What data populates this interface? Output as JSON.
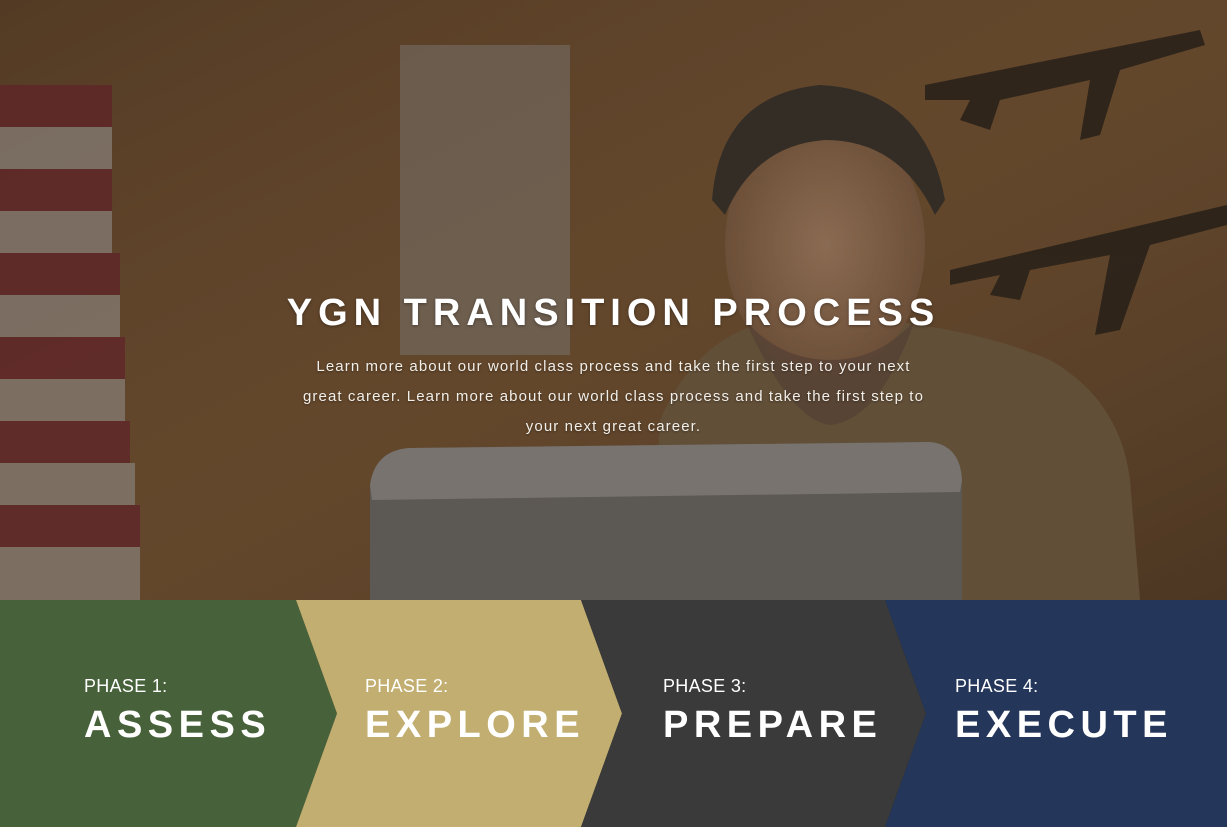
{
  "hero": {
    "title": "YGN TRANSITION PROCESS",
    "description": "Learn more about our world class process and take the first step to your next great career. Learn more about our world class process and take the first step to your next great career."
  },
  "phases": [
    {
      "number": "PHASE 1:",
      "name": "ASSESS",
      "color": "#47623a"
    },
    {
      "number": "PHASE 2:",
      "name": "EXPLORE",
      "color": "#c1ae70"
    },
    {
      "number": "PHASE 3:",
      "name": "PREPARE",
      "color": "#3a3a3b"
    },
    {
      "number": "PHASE 4:",
      "name": "EXECUTE",
      "color": "#243659"
    }
  ]
}
